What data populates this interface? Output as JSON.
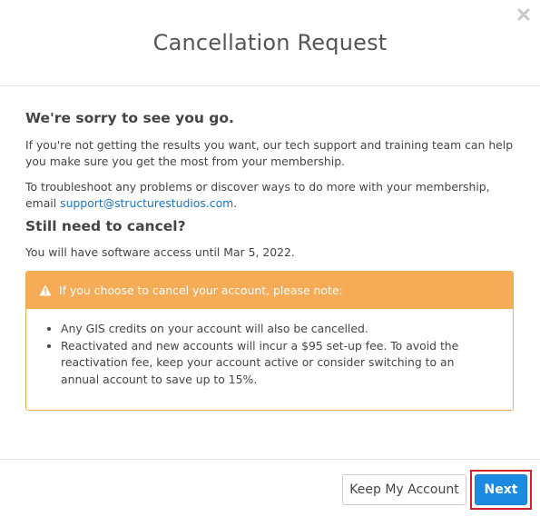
{
  "dialog": {
    "title": "Cancellation Request",
    "close_icon": "close-icon"
  },
  "content": {
    "sorry_heading": "We're sorry to see you go.",
    "paragraph1": "If you're not getting the results you want, our tech support and training team can help you make sure you get the most from your membership.",
    "paragraph2_prefix": "To troubleshoot any problems or discover ways to do more with your membership, email ",
    "support_email": "support@structurestudios.com",
    "paragraph2_suffix": ".",
    "cancel_heading": "Still need to cancel?",
    "access_text": "You will have software access until Mar 5, 2022."
  },
  "notice": {
    "icon": "warning-icon",
    "heading": "If you choose to cancel your account, please note:",
    "items": [
      "Any GIS credits on your account will also be cancelled.",
      "Reactivated and new accounts will incur a $95 set-up fee. To avoid the reactivation fee, keep your account active or consider switching to an annual account to save up to 15%."
    ]
  },
  "footer": {
    "keep_label": "Keep My Account",
    "next_label": "Next"
  },
  "colors": {
    "accent": "#1c8ae0",
    "warning": "#f6ab57",
    "highlight": "#d32026",
    "link": "#1a73c9"
  }
}
